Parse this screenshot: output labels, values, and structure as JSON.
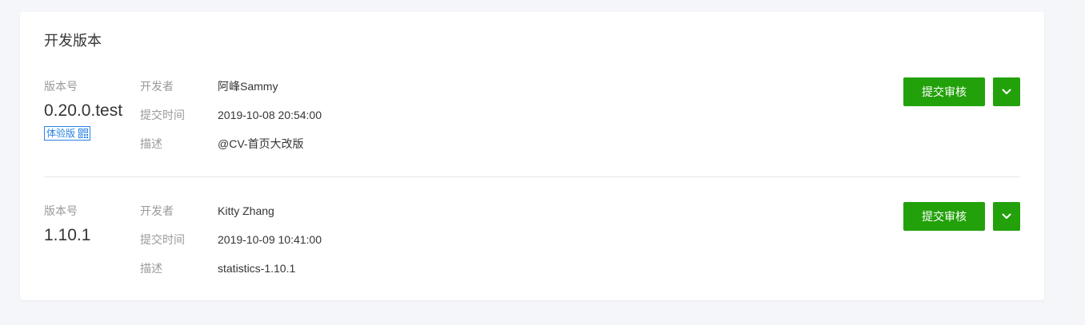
{
  "section": {
    "title": "开发版本"
  },
  "versions": [
    {
      "version_label": "版本号",
      "version": "0.20.0.test",
      "badge": "体验版",
      "developer_label": "开发者",
      "developer": "阿峰Sammy",
      "submit_time_label": "提交时间",
      "submit_time": "2019-10-08 20:54:00",
      "desc_label": "描述",
      "desc": "@CV-首页大改版",
      "submit_button": "提交审核"
    },
    {
      "version_label": "版本号",
      "version": "1.10.1",
      "developer_label": "开发者",
      "developer": "Kitty Zhang",
      "submit_time_label": "提交时间",
      "submit_time": "2019-10-09 10:41:00",
      "desc_label": "描述",
      "desc": "statistics-1.10.1",
      "submit_button": "提交审核"
    }
  ],
  "icons": {
    "badge_icon": "qr-code-icon",
    "dropdown_icon": "chevron-down-icon"
  },
  "colors": {
    "primary": "#23a10b",
    "badge": "#2a82e4",
    "label": "#9a9a9a",
    "text": "#353535",
    "background": "#f5f6f9"
  }
}
